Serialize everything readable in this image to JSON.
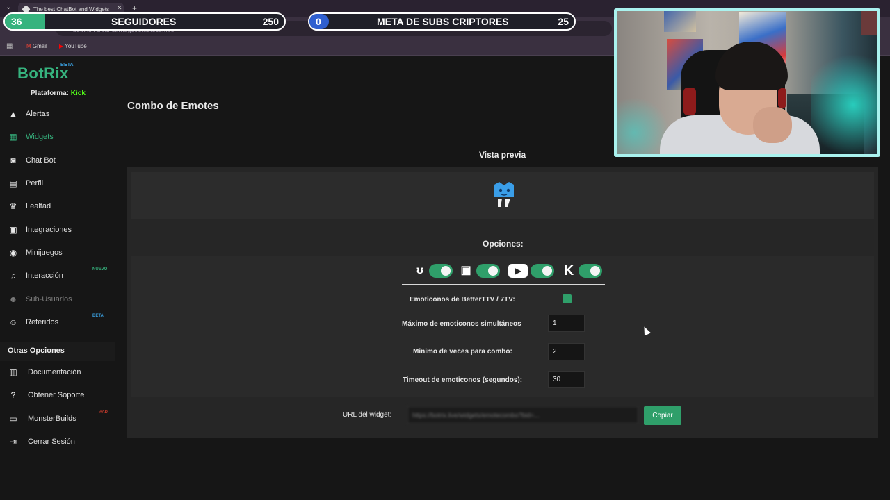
{
  "browser": {
    "tab_title": "The best ChatBot and Widgets",
    "url": "botrix.live/panel/widget/emotecombo",
    "bookmarks": [
      "Gmail",
      "YouTube"
    ]
  },
  "overlay": {
    "followers": {
      "current": "36",
      "title": "SEGUIDORES",
      "goal": "250",
      "progress": 0.144,
      "fill_color": "#36b37e"
    },
    "subs": {
      "current": "0",
      "title": "META DE SUBS CRIPTORES",
      "goal": "25",
      "progress": 0.0,
      "fill_color": "#2f5fd0"
    }
  },
  "app": {
    "logo": "BotRix",
    "logo_badge": "BETA",
    "accent": "#36b37e"
  },
  "sidebar": {
    "platform_label": "Plataforma:",
    "platform_value": "Kick",
    "items": [
      {
        "label": "Alertas",
        "icon": "warning-icon"
      },
      {
        "label": "Widgets",
        "icon": "grid-icon",
        "active": true
      },
      {
        "label": "Chat Bot",
        "icon": "robot-icon"
      },
      {
        "label": "Perfil",
        "icon": "id-card-icon"
      },
      {
        "label": "Lealtad",
        "icon": "trophy-icon"
      },
      {
        "label": "Integraciones",
        "icon": "plug-icon"
      },
      {
        "label": "Minijuegos",
        "icon": "gamepad-icon"
      },
      {
        "label": "Interacción",
        "icon": "music-icon",
        "badge": "NUEVO",
        "badge_color": "#36b37e"
      },
      {
        "label": "Sub-Usuarios",
        "icon": "users-icon",
        "disabled": true
      },
      {
        "label": "Referidos",
        "icon": "user-group-icon",
        "badge": "BETA",
        "badge_color": "#3aa0e0"
      }
    ],
    "other_title": "Otras Opciones",
    "other_items": [
      {
        "label": "Documentación",
        "icon": "book-icon"
      },
      {
        "label": "Obtener Soporte",
        "icon": "question-icon"
      },
      {
        "label": "MonsterBuilds",
        "icon": "laptop-icon",
        "badge": "#AD",
        "badge_color": "#c0392b"
      },
      {
        "label": "Cerrar Sesión",
        "icon": "logout-icon"
      }
    ]
  },
  "main": {
    "title": "Combo de Emotes",
    "preview_title": "Vista previa",
    "options_title": "Opciones:",
    "platforms": [
      {
        "name": "kick-alt",
        "icon": "bttv-icon",
        "enabled": true
      },
      {
        "name": "twitch",
        "icon": "twitch-icon",
        "enabled": true
      },
      {
        "name": "youtube",
        "icon": "youtube-icon",
        "enabled": true
      },
      {
        "name": "kick",
        "icon": "kick-icon",
        "enabled": true
      }
    ],
    "options": {
      "bttv_label": "Emoticonos de BetterTTV / 7TV:",
      "bttv_checked": true,
      "max_label": "Máximo de emoticonos simultáneos",
      "max_value": "1",
      "min_label": "Minimo de veces para combo:",
      "min_value": "2",
      "timeout_label": "Timeout de emoticonos (segundos):",
      "timeout_value": "30"
    },
    "url_label": "URL del widget:",
    "url_value": "https://botrix.live/widgets/emotecombo?bid=...",
    "copy_label": "Copiar"
  }
}
